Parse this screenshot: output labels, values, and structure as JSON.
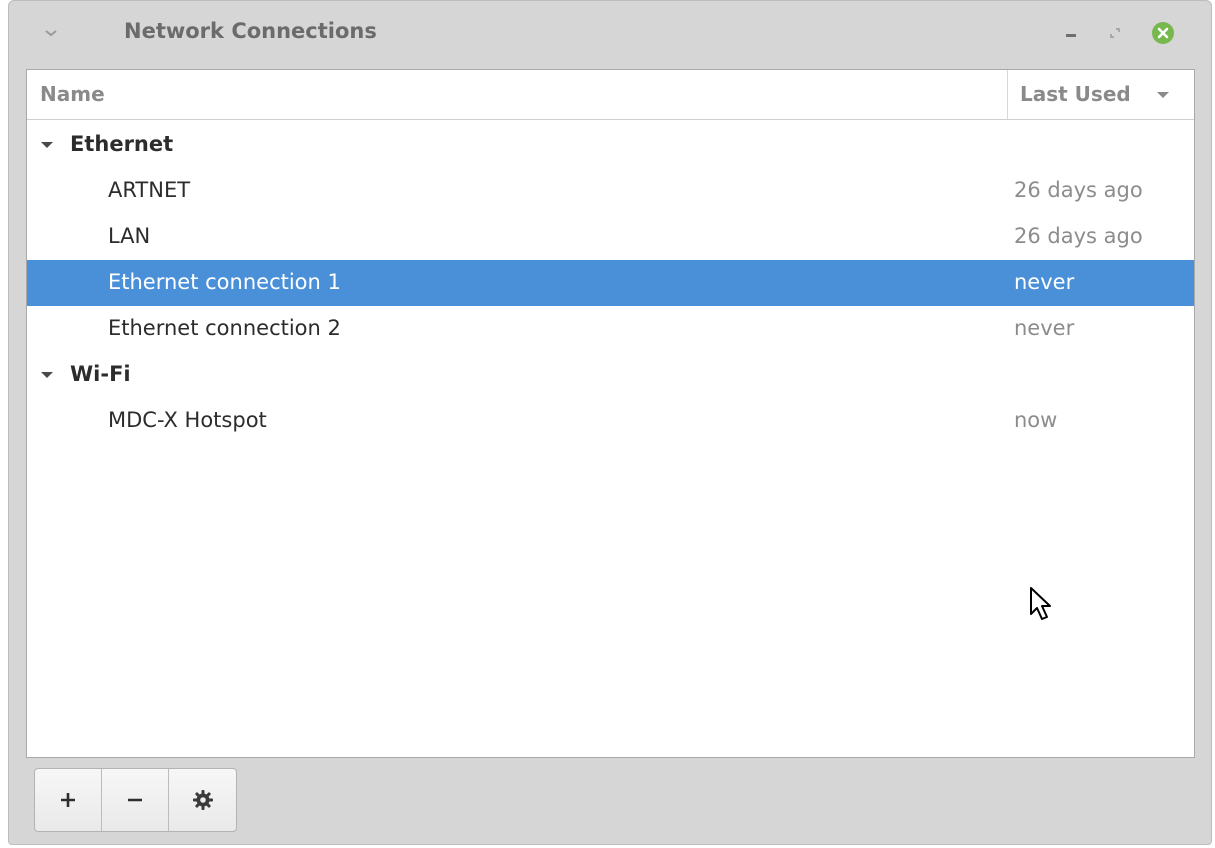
{
  "window": {
    "title": "Network Connections"
  },
  "columns": {
    "name": "Name",
    "last_used": "Last Used"
  },
  "groups": [
    {
      "label": "Ethernet",
      "connections": [
        {
          "name": "ARTNET",
          "last_used": "26 days ago",
          "selected": false
        },
        {
          "name": "LAN",
          "last_used": "26 days ago",
          "selected": false
        },
        {
          "name": "Ethernet connection 1",
          "last_used": "never",
          "selected": true
        },
        {
          "name": "Ethernet connection 2",
          "last_used": "never",
          "selected": false
        }
      ]
    },
    {
      "label": "Wi-Fi",
      "connections": [
        {
          "name": "MDC-X Hotspot",
          "last_used": "now",
          "selected": false
        }
      ]
    }
  ],
  "toolbar": {
    "add_icon": "plus-icon",
    "remove_icon": "minus-icon",
    "settings_icon": "gear-icon"
  },
  "colors": {
    "selection": "#4a90d9",
    "close_button": "#76b84e"
  }
}
